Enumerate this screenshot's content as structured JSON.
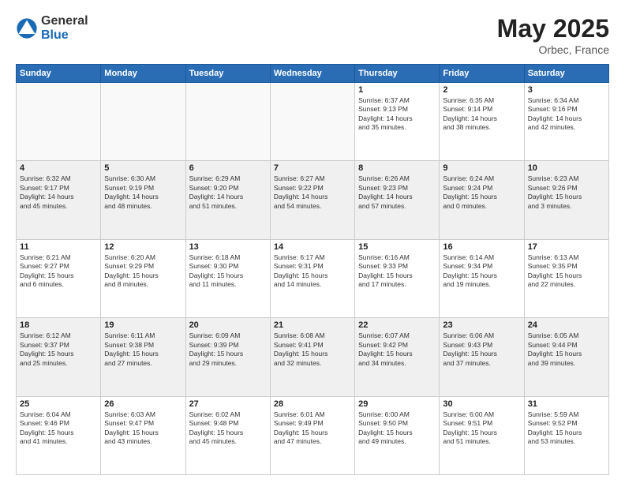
{
  "logo": {
    "general": "General",
    "blue": "Blue"
  },
  "title": "May 2025",
  "location": "Orbec, France",
  "headers": [
    "Sunday",
    "Monday",
    "Tuesday",
    "Wednesday",
    "Thursday",
    "Friday",
    "Saturday"
  ],
  "weeks": [
    [
      {
        "day": "",
        "info": ""
      },
      {
        "day": "",
        "info": ""
      },
      {
        "day": "",
        "info": ""
      },
      {
        "day": "",
        "info": ""
      },
      {
        "day": "1",
        "info": "Sunrise: 6:37 AM\nSunset: 9:13 PM\nDaylight: 14 hours\nand 35 minutes."
      },
      {
        "day": "2",
        "info": "Sunrise: 6:35 AM\nSunset: 9:14 PM\nDaylight: 14 hours\nand 38 minutes."
      },
      {
        "day": "3",
        "info": "Sunrise: 6:34 AM\nSunset: 9:16 PM\nDaylight: 14 hours\nand 42 minutes."
      }
    ],
    [
      {
        "day": "4",
        "info": "Sunrise: 6:32 AM\nSunset: 9:17 PM\nDaylight: 14 hours\nand 45 minutes."
      },
      {
        "day": "5",
        "info": "Sunrise: 6:30 AM\nSunset: 9:19 PM\nDaylight: 14 hours\nand 48 minutes."
      },
      {
        "day": "6",
        "info": "Sunrise: 6:29 AM\nSunset: 9:20 PM\nDaylight: 14 hours\nand 51 minutes."
      },
      {
        "day": "7",
        "info": "Sunrise: 6:27 AM\nSunset: 9:22 PM\nDaylight: 14 hours\nand 54 minutes."
      },
      {
        "day": "8",
        "info": "Sunrise: 6:26 AM\nSunset: 9:23 PM\nDaylight: 14 hours\nand 57 minutes."
      },
      {
        "day": "9",
        "info": "Sunrise: 6:24 AM\nSunset: 9:24 PM\nDaylight: 15 hours\nand 0 minutes."
      },
      {
        "day": "10",
        "info": "Sunrise: 6:23 AM\nSunset: 9:26 PM\nDaylight: 15 hours\nand 3 minutes."
      }
    ],
    [
      {
        "day": "11",
        "info": "Sunrise: 6:21 AM\nSunset: 9:27 PM\nDaylight: 15 hours\nand 6 minutes."
      },
      {
        "day": "12",
        "info": "Sunrise: 6:20 AM\nSunset: 9:29 PM\nDaylight: 15 hours\nand 8 minutes."
      },
      {
        "day": "13",
        "info": "Sunrise: 6:18 AM\nSunset: 9:30 PM\nDaylight: 15 hours\nand 11 minutes."
      },
      {
        "day": "14",
        "info": "Sunrise: 6:17 AM\nSunset: 9:31 PM\nDaylight: 15 hours\nand 14 minutes."
      },
      {
        "day": "15",
        "info": "Sunrise: 6:16 AM\nSunset: 9:33 PM\nDaylight: 15 hours\nand 17 minutes."
      },
      {
        "day": "16",
        "info": "Sunrise: 6:14 AM\nSunset: 9:34 PM\nDaylight: 15 hours\nand 19 minutes."
      },
      {
        "day": "17",
        "info": "Sunrise: 6:13 AM\nSunset: 9:35 PM\nDaylight: 15 hours\nand 22 minutes."
      }
    ],
    [
      {
        "day": "18",
        "info": "Sunrise: 6:12 AM\nSunset: 9:37 PM\nDaylight: 15 hours\nand 25 minutes."
      },
      {
        "day": "19",
        "info": "Sunrise: 6:11 AM\nSunset: 9:38 PM\nDaylight: 15 hours\nand 27 minutes."
      },
      {
        "day": "20",
        "info": "Sunrise: 6:09 AM\nSunset: 9:39 PM\nDaylight: 15 hours\nand 29 minutes."
      },
      {
        "day": "21",
        "info": "Sunrise: 6:08 AM\nSunset: 9:41 PM\nDaylight: 15 hours\nand 32 minutes."
      },
      {
        "day": "22",
        "info": "Sunrise: 6:07 AM\nSunset: 9:42 PM\nDaylight: 15 hours\nand 34 minutes."
      },
      {
        "day": "23",
        "info": "Sunrise: 6:06 AM\nSunset: 9:43 PM\nDaylight: 15 hours\nand 37 minutes."
      },
      {
        "day": "24",
        "info": "Sunrise: 6:05 AM\nSunset: 9:44 PM\nDaylight: 15 hours\nand 39 minutes."
      }
    ],
    [
      {
        "day": "25",
        "info": "Sunrise: 6:04 AM\nSunset: 9:46 PM\nDaylight: 15 hours\nand 41 minutes."
      },
      {
        "day": "26",
        "info": "Sunrise: 6:03 AM\nSunset: 9:47 PM\nDaylight: 15 hours\nand 43 minutes."
      },
      {
        "day": "27",
        "info": "Sunrise: 6:02 AM\nSunset: 9:48 PM\nDaylight: 15 hours\nand 45 minutes."
      },
      {
        "day": "28",
        "info": "Sunrise: 6:01 AM\nSunset: 9:49 PM\nDaylight: 15 hours\nand 47 minutes."
      },
      {
        "day": "29",
        "info": "Sunrise: 6:00 AM\nSunset: 9:50 PM\nDaylight: 15 hours\nand 49 minutes."
      },
      {
        "day": "30",
        "info": "Sunrise: 6:00 AM\nSunset: 9:51 PM\nDaylight: 15 hours\nand 51 minutes."
      },
      {
        "day": "31",
        "info": "Sunrise: 5:59 AM\nSunset: 9:52 PM\nDaylight: 15 hours\nand 53 minutes."
      }
    ]
  ]
}
